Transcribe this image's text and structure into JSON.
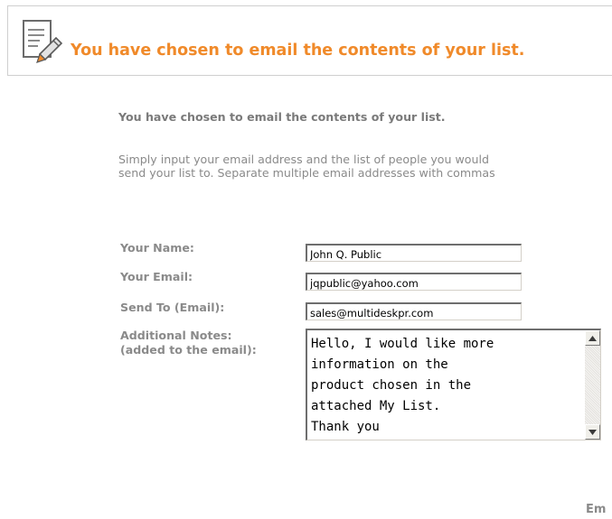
{
  "header": {
    "icon": "note-pencil-icon",
    "title": "You have chosen to email the contents of your list."
  },
  "intro": {
    "heading": "You have chosen to email the contents of your list.",
    "line1": "Simply input your email address and the list of people you would",
    "line2": "send your list to. Separate multiple email addresses with commas"
  },
  "form": {
    "name": {
      "label": "Your Name:",
      "value": "John Q. Public"
    },
    "email": {
      "label": "Your Email:",
      "value": "jqpublic@yahoo.com"
    },
    "send_to": {
      "label": "Send To (Email):",
      "value": "sales@multideskpr.com"
    },
    "notes": {
      "label_line1": "Additional Notes:",
      "label_line2": "(added to the email):",
      "value": "Hello, I would like more\ninformation on the\nproduct chosen in the\nattached My List.\nThank you"
    }
  },
  "footer": {
    "partial_button_text": "Em"
  },
  "colors": {
    "accent": "#f08a2a",
    "label_gray": "#8a8a8a"
  }
}
